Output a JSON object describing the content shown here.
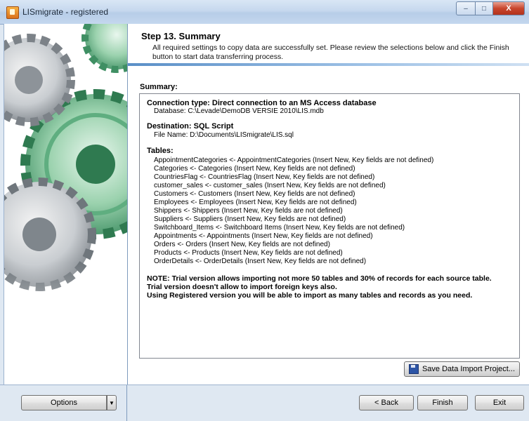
{
  "window": {
    "title": "LISmigrate - registered",
    "controls": {
      "minimize": "–",
      "maximize": "□",
      "close": "X"
    }
  },
  "header": {
    "step_title": "Step 13. Summary",
    "description": "All required settings to copy data are successfully set. Please review the selections below and click the Finish button to start data transferring process."
  },
  "summary": {
    "label": "Summary:",
    "connection": {
      "title": "Connection type: Direct connection to an MS Access database",
      "detail": "Database: C:\\Levade\\DemoDB VERSIE 2010\\LIS.mdb"
    },
    "destination": {
      "title": "Destination: SQL Script",
      "detail": "File Name: D:\\Documents\\LISmigrate\\LIS.sql"
    },
    "tables": {
      "title": "Tables:",
      "items": [
        "AppointmentCategories <- AppointmentCategories (Insert New, Key fields are not defined)",
        "Categories <- Categories (Insert New, Key fields are not defined)",
        "CountriesFlag <- CountriesFlag (Insert New, Key fields are not defined)",
        "customer_sales <- customer_sales (Insert New, Key fields are not defined)",
        "Customers <- Customers (Insert New, Key fields are not defined)",
        "Employees <- Employees (Insert New, Key fields are not defined)",
        "Shippers <- Shippers (Insert New, Key fields are not defined)",
        "Suppliers <- Suppliers (Insert New, Key fields are not defined)",
        "Switchboard_Items <- Switchboard Items (Insert New, Key fields are not defined)",
        "Appointments <- Appointments (Insert New, Key fields are not defined)",
        "Orders <- Orders (Insert New, Key fields are not defined)",
        "Products <- Products (Insert New, Key fields are not defined)",
        "OrderDetails <- OrderDetails (Insert New, Key fields are not defined)"
      ]
    },
    "notes": [
      "NOTE: Trial version allows importing not more 50 tables and 30% of records for each source table.",
      "Trial version doesn't allow to import foreign keys also.",
      "Using Registered version you will be able to import as many tables and records as you need."
    ]
  },
  "buttons": {
    "save_project": "Save Data Import Project...",
    "options": "Options",
    "back": "< Back",
    "finish": "Finish",
    "exit": "Exit"
  },
  "icons": {
    "options_dropdown": "▼"
  }
}
